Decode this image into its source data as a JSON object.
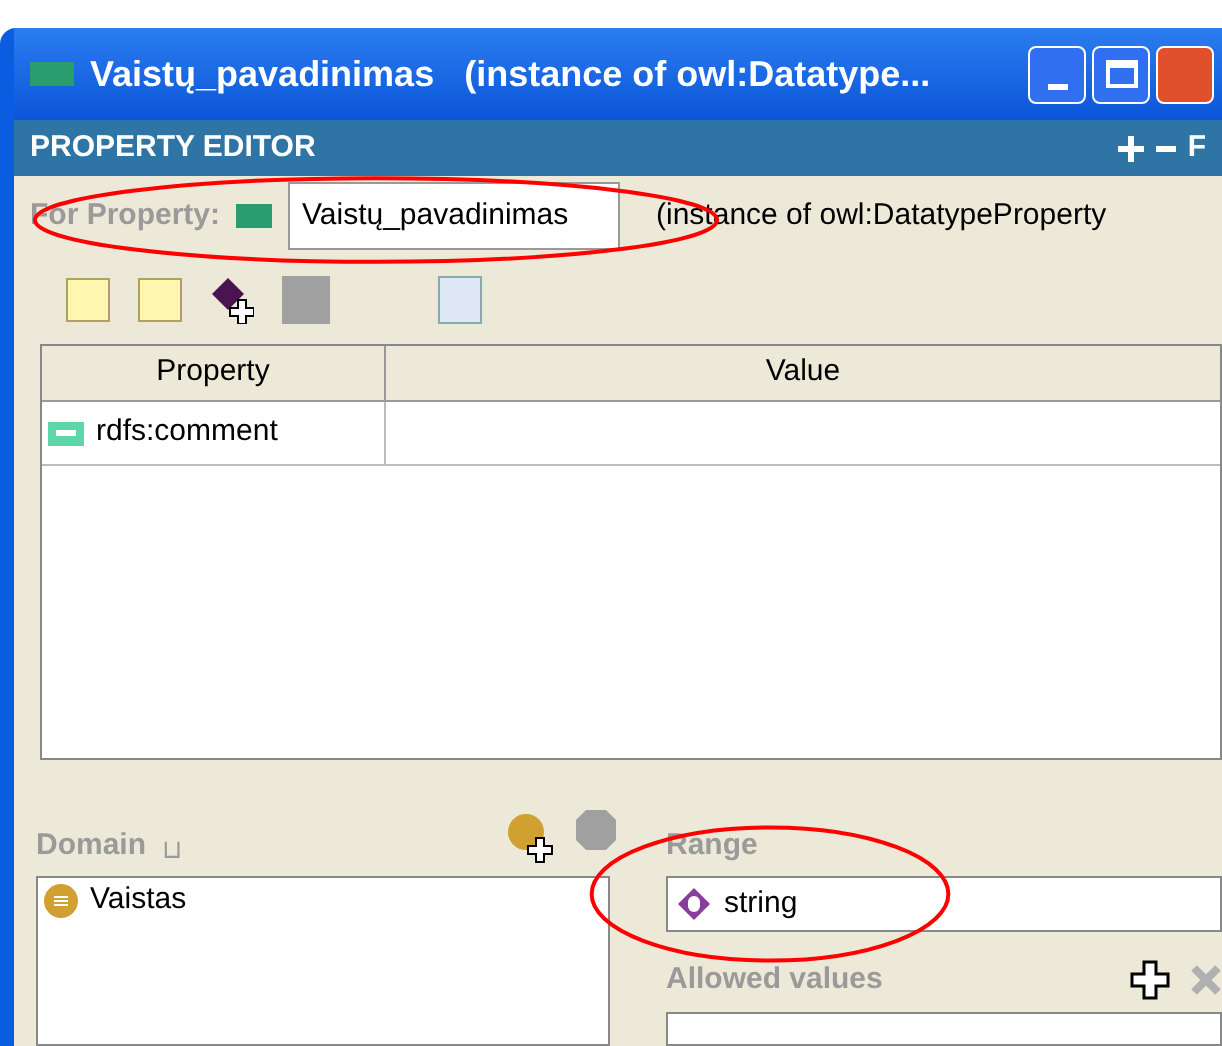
{
  "window": {
    "title": "Vaistų_pavadinimas   (instance of owl:Datatype..."
  },
  "panel": {
    "title": "PROPERTY EDITOR",
    "header_letter": "F"
  },
  "for_property": {
    "circled": true,
    "label": "For Property:",
    "value": "Vaistų_pavadinimas",
    "type_text": "(instance of owl:DatatypeProperty"
  },
  "table": {
    "columns": [
      "Property",
      "Value"
    ],
    "rows": [
      {
        "property": "rdfs:comment"
      }
    ]
  },
  "domain": {
    "label": "Domain",
    "symbol": "⊔",
    "items": [
      {
        "name": "Vaistas"
      }
    ]
  },
  "range": {
    "circled": true,
    "label": "Range",
    "value": "string",
    "allowed_values_label": "Allowed values"
  }
}
